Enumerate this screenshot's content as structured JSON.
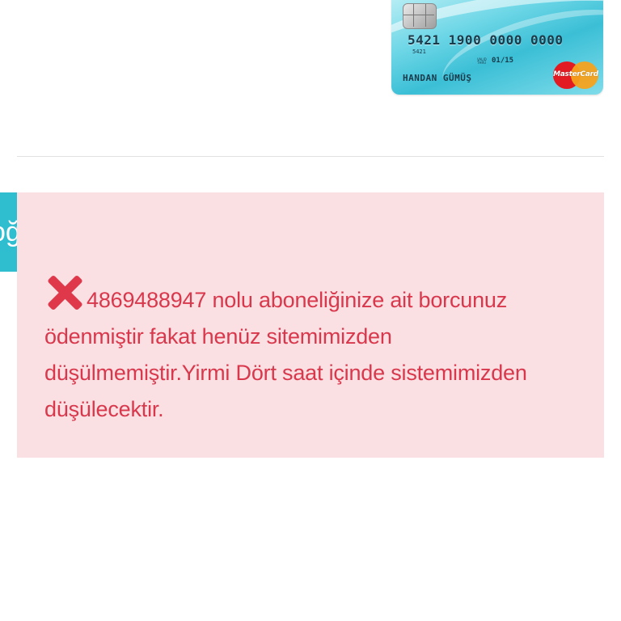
{
  "card": {
    "number": "5421 1900 0000 0000",
    "small_number": "5421",
    "valid_label": "VALID THRU",
    "expiry": "01/15",
    "holder": "HANDAN GÜMÜŞ",
    "brand": "MasterCard"
  },
  "side_tab": {
    "label_fragment": "oğ"
  },
  "alert": {
    "icon": "close-icon",
    "message": "4869488947 nolu aboneliğinize ait borcunuz ödenmiştir fakat henüz sitemimizden düşülmemiştir.Yirmi Dört saat içinde sistemimizden düşülecektir.",
    "color": "#d9384c",
    "background": "#fadfe3"
  },
  "colors": {
    "teal_accent": "#2fbdd0",
    "divider": "#e2e2e2"
  }
}
